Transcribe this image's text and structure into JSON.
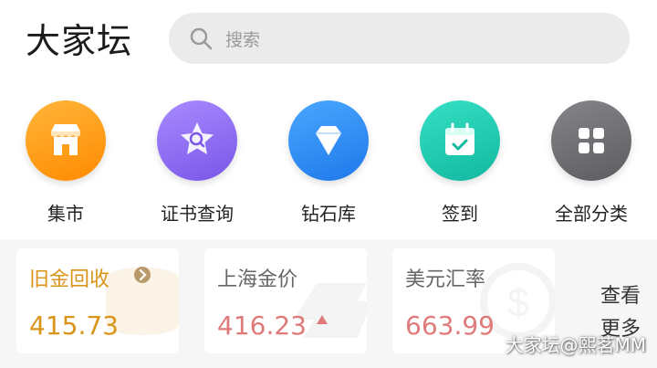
{
  "app": {
    "logo": "大家坛"
  },
  "search": {
    "placeholder": "搜索",
    "icon": "search-icon"
  },
  "shortcuts": [
    {
      "label": "集市",
      "icon": "store-icon",
      "color": "#ff9f1a"
    },
    {
      "label": "证书查询",
      "icon": "star-search-icon",
      "color": "#8e6cf0"
    },
    {
      "label": "钻石库",
      "icon": "diamond-icon",
      "color": "#2e8ff5"
    },
    {
      "label": "签到",
      "icon": "calendar-check-icon",
      "color": "#1fcfb4"
    },
    {
      "label": "全部分类",
      "icon": "grid-icon",
      "color": "#6f6f74"
    }
  ],
  "prices": [
    {
      "title": "旧金回收",
      "value": "415.73",
      "value_color": "#d9941a",
      "title_color": "#d9941a"
    },
    {
      "title": "上海金价",
      "value": "416.23",
      "value_color": "#e07a7a",
      "title_color": "#666666",
      "trend": "up"
    },
    {
      "title": "美元汇率",
      "value": "663.99",
      "value_color": "#e07a7a",
      "title_color": "#666666"
    }
  ],
  "more": {
    "line1": "查看",
    "line2": "更多"
  },
  "watermark": "大家坛@熙茗MM"
}
